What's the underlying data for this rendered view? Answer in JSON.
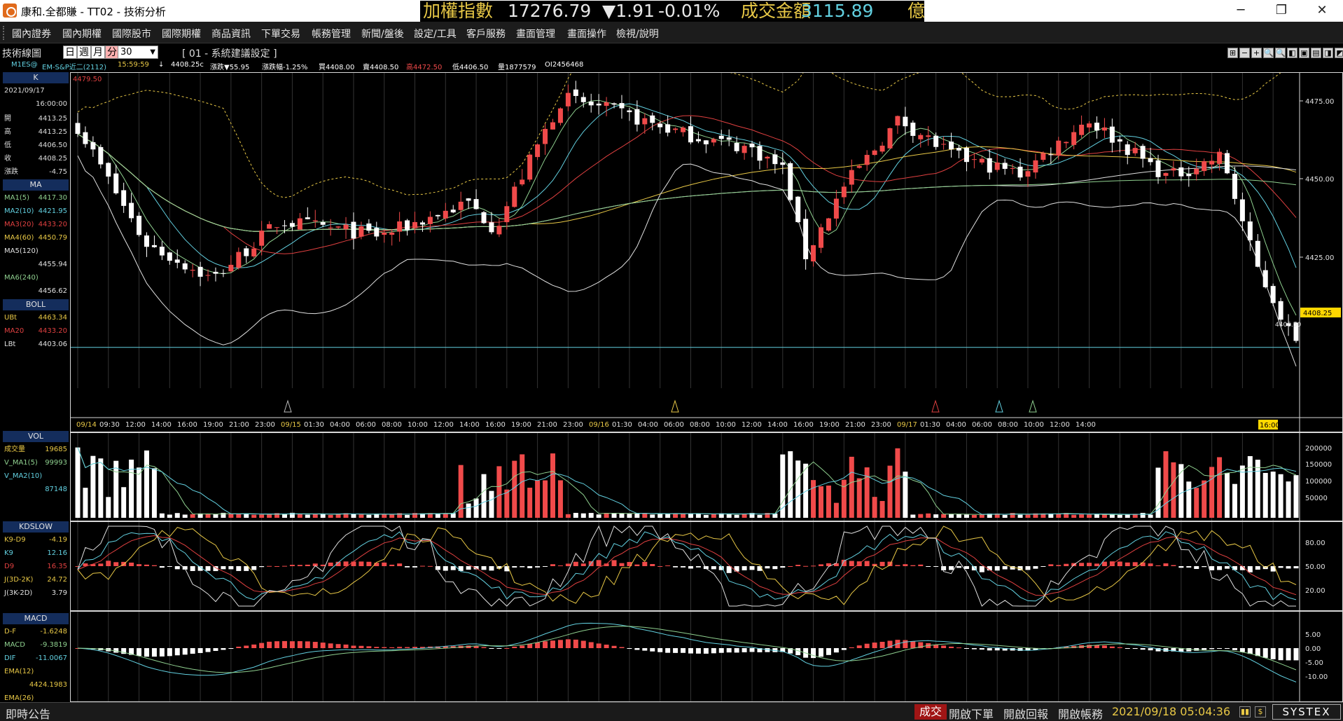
{
  "window": {
    "title": "康和.全都賺 - TT02 - 技術分析",
    "buttons": {
      "minimize": "─",
      "restore": "❐",
      "close": "✕"
    }
  },
  "ticker": {
    "index_label": "加權指數",
    "index_value": "17276.79",
    "change": "▼1.91",
    "change_pct": "-0.01%",
    "amount_label": "成交金額",
    "amount_value": "3115.89",
    "amount_unit": "億"
  },
  "menu": [
    "國內證券",
    "國內期權",
    "國際股市",
    "國際期權",
    "商品資訊",
    "下單交易",
    "帳務管理",
    "新聞/盤後",
    "設定/工具",
    "客戶服務",
    "畫面管理",
    "畫面操作",
    "檢視/說明"
  ],
  "toolbar": {
    "title": "技術線圖",
    "periods": [
      "日",
      "週",
      "月",
      "分"
    ],
    "active_period": "分",
    "interval": "30",
    "setting": "[ 01 - 系統建議設定 ]",
    "icons": [
      "⊞",
      "−",
      "+",
      "🔍",
      "🔍",
      "◧",
      "▣",
      "▤",
      "◨",
      "◩"
    ]
  },
  "quote": {
    "symbol": "M1ES@",
    "name": "EM-S&P近二(2112)",
    "time": "15:59:59",
    "arrow": "↓",
    "price": "4408.25c",
    "change": "漲跌▼55.95",
    "change_pct": "漲跌幅-1.25%",
    "bid": "買4408.00",
    "ask": "賣4408.50",
    "high": "高4472.50",
    "low": "低4406.50",
    "volume": "量1877579",
    "oi": "OI2456468"
  },
  "side": {
    "k_title": "K",
    "date": "2021/09/17",
    "time": "16:00:00",
    "k_rows": [
      {
        "label": "開",
        "value": "4413.25",
        "color": "#dddddd"
      },
      {
        "label": "高",
        "value": "4413.25",
        "color": "#dddddd"
      },
      {
        "label": "低",
        "value": "4406.50",
        "color": "#dddddd"
      },
      {
        "label": "收",
        "value": "4408.25",
        "color": "#dddddd"
      },
      {
        "label": "漲跌",
        "value": "-4.75",
        "color": "#dddddd"
      }
    ],
    "ma_title": "MA",
    "ma_rows": [
      {
        "label": "MA1(5)",
        "value": "4417.30",
        "color": "#8fd08f"
      },
      {
        "label": "MA2(10)",
        "value": "4421.95",
        "color": "#62d0e0"
      },
      {
        "label": "MA3(20)",
        "value": "4433.20",
        "color": "#e04040"
      },
      {
        "label": "MA4(60)",
        "value": "4450.79",
        "color": "#e8c846"
      },
      {
        "label": "MA5(120)",
        "value": "",
        "color": "#e0e0e0"
      },
      {
        "label": "",
        "value": "4455.94",
        "color": "#e0e0e0"
      },
      {
        "label": "MA6(240)",
        "value": "",
        "color": "#8fd08f"
      },
      {
        "label": "",
        "value": "4456.62",
        "color": "#e0e0e0"
      }
    ],
    "boll_title": "BOLL",
    "boll_rows": [
      {
        "label": "UBt",
        "value": "4463.34",
        "color": "#e8c846"
      },
      {
        "label": "MA20",
        "value": "4433.20",
        "color": "#e04040"
      },
      {
        "label": "LBt",
        "value": "4403.06",
        "color": "#e0e0e0"
      }
    ],
    "vol_title": "VOL",
    "vol_rows": [
      {
        "label": "成交量",
        "value": "19685",
        "color": "#e8c846"
      },
      {
        "label": "V_MA1(5)",
        "value": "99993",
        "color": "#8fd08f"
      },
      {
        "label": "V_MA2(10)",
        "value": "",
        "color": "#62d0e0"
      },
      {
        "label": "",
        "value": "87148",
        "color": "#62d0e0"
      }
    ],
    "kd_title": "KDSLOW",
    "kd_rows": [
      {
        "label": "K9-D9",
        "value": "-4.19",
        "color": "#e8c846"
      },
      {
        "label": "K9",
        "value": "12.16",
        "color": "#62d0e0"
      },
      {
        "label": "D9",
        "value": "16.35",
        "color": "#e04040"
      },
      {
        "label": "J(3D-2K)",
        "value": "24.72",
        "color": "#e8c846"
      },
      {
        "label": "J(3K-2D)",
        "value": "3.79",
        "color": "#e0e0e0"
      }
    ],
    "macd_title": "MACD",
    "macd_rows": [
      {
        "label": "D-F",
        "value": "-1.6248",
        "color": "#e8c846"
      },
      {
        "label": "MACD",
        "value": "-9.3819",
        "color": "#8fd08f"
      },
      {
        "label": "DIF",
        "value": "-11.0067",
        "color": "#62d0e0"
      },
      {
        "label": "EMA(12)",
        "value": "",
        "color": "#e8c846"
      },
      {
        "label": "",
        "value": "4424.1983",
        "color": "#e8c846"
      },
      {
        "label": "EMA(26)",
        "value": "",
        "color": "#e8c846"
      }
    ]
  },
  "main_chart": {
    "top_left_price": "4479.50",
    "axis_ticks": [
      "4475.00",
      "4450.00",
      "4425.00"
    ],
    "current_price": "4408.25",
    "low_label": "4406.50",
    "time_labels": [
      {
        "t": "09/14",
        "date": true
      },
      {
        "t": "09:30"
      },
      {
        "t": "12:00"
      },
      {
        "t": "14:00"
      },
      {
        "t": "16:00"
      },
      {
        "t": "19:00"
      },
      {
        "t": "21:00"
      },
      {
        "t": "23:00"
      },
      {
        "t": "09/15",
        "date": true
      },
      {
        "t": "01:30"
      },
      {
        "t": "04:00"
      },
      {
        "t": "06:00"
      },
      {
        "t": "08:00"
      },
      {
        "t": "10:00"
      },
      {
        "t": "12:00"
      },
      {
        "t": "14:00"
      },
      {
        "t": "16:00"
      },
      {
        "t": "19:00"
      },
      {
        "t": "21:00"
      },
      {
        "t": "23:00"
      },
      {
        "t": "09/16",
        "date": true
      },
      {
        "t": "01:30"
      },
      {
        "t": "04:00"
      },
      {
        "t": "06:00"
      },
      {
        "t": "08:00"
      },
      {
        "t": "10:00"
      },
      {
        "t": "12:00"
      },
      {
        "t": "14:00"
      },
      {
        "t": "16:00"
      },
      {
        "t": "19:00"
      },
      {
        "t": "21:00"
      },
      {
        "t": "23:00"
      },
      {
        "t": "09/17",
        "date": true
      },
      {
        "t": "01:30"
      },
      {
        "t": "04:00"
      },
      {
        "t": "06:00"
      },
      {
        "t": "08:00"
      },
      {
        "t": "10:00"
      },
      {
        "t": "12:00"
      },
      {
        "t": "14:00"
      }
    ],
    "last_time": "16:00"
  },
  "vol_chart": {
    "axis_ticks": [
      "200000",
      "150000",
      "100000",
      "50000"
    ]
  },
  "kd_chart": {
    "axis_ticks": [
      "80.00",
      "50.00",
      "20.00"
    ]
  },
  "macd_chart": {
    "axis_ticks": [
      "5.00",
      "0.00",
      "-5.00",
      "-10.00"
    ]
  },
  "status": {
    "announce": "即時公告",
    "trade": "成交",
    "buttons": [
      "開啟下單",
      "開啟回報",
      "開啟帳務"
    ],
    "datetime": "2021/09/18 05:04:36",
    "brand": "SYSTEX"
  },
  "colors": {
    "up": "#f04a4a",
    "down": "#ffffff",
    "ma5": "#8fd08f",
    "ma10": "#62d0e0",
    "ma20": "#e04040",
    "ma60": "#e8c846",
    "ma120": "#e0e0e0",
    "ma240": "#8fd08f",
    "boll_upper": "#e8c846",
    "boll_lower": "#e0e0e0",
    "grid": "#333333"
  }
}
